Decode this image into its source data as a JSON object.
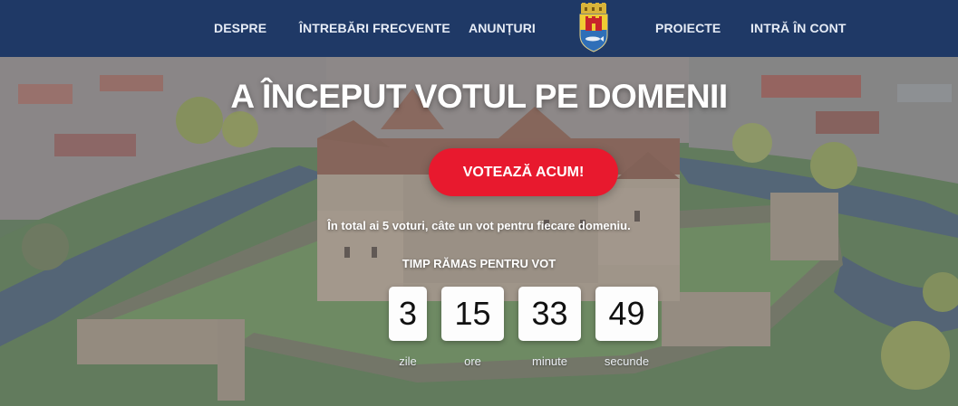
{
  "nav": {
    "items": [
      {
        "label": "DESPRE"
      },
      {
        "label": "ÎNTREBĂRI FRECVENTE"
      },
      {
        "label": "ANUNȚURI"
      },
      {
        "label": "PROIECTE"
      },
      {
        "label": "INTRĂ ÎN CONT"
      }
    ],
    "logo_icon": "city-coat-of-arms-icon"
  },
  "hero": {
    "title": "A ÎNCEPUT VOTUL PE DOMENII",
    "vote_button": "VOTEAZĂ ACUM!",
    "info_text": "În total ai 5 voturi, câte un vot pentru fiecare domeniu.",
    "timer_label": "TIMP RĂMAS PENTRU VOT",
    "countdown": [
      {
        "value": "3",
        "unit": "zile"
      },
      {
        "value": "15",
        "unit": "ore"
      },
      {
        "value": "33",
        "unit": "minute"
      },
      {
        "value": "49",
        "unit": "secunde"
      }
    ]
  },
  "colors": {
    "nav_bg": "#1f3966",
    "accent_button": "#e8192e"
  }
}
